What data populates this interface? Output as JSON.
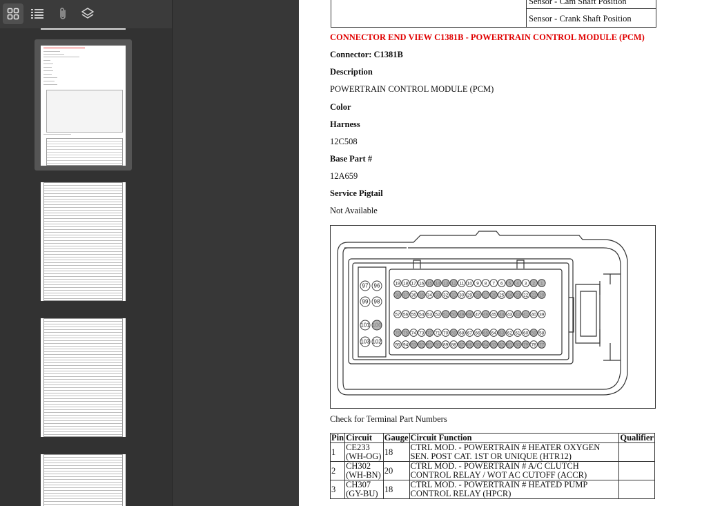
{
  "toolbar": {
    "buttons": [
      {
        "name": "thumbnails-view",
        "icon": "grid-icon"
      },
      {
        "name": "outline-view",
        "icon": "list-icon"
      },
      {
        "name": "attachments-view",
        "icon": "paperclip-icon"
      },
      {
        "name": "layers-view",
        "icon": "layers-icon"
      }
    ]
  },
  "document": {
    "top_table": {
      "row1": "Sensor - Cam Shaft Position",
      "row2": "Sensor - Crank Shaft Position"
    },
    "heading": "CONNECTOR END VIEW C1381B - POWERTRAIN CONTROL MODULE (PCM)",
    "connector": "Connector: C1381B",
    "description_label": "Description",
    "description_value": "POWERTRAIN CONTROL MODULE (PCM)",
    "color_label": "Color",
    "harness_label": "Harness",
    "harness_value": "12C508",
    "base_part_label": "Base Part #",
    "base_part_value": "12A659",
    "service_pigtail_label": "Service Pigtail",
    "service_pigtail_value": "Not Available",
    "figure": {
      "pins_row1": [
        "19",
        "18",
        "17",
        "16",
        "15",
        "14",
        "13",
        "12",
        "11",
        "10",
        "9",
        "8",
        "7",
        "6",
        "5",
        "4",
        "3",
        "2",
        "1"
      ],
      "pins_row2": [
        "38",
        "37",
        "36",
        "35",
        "34",
        "33",
        "32",
        "31",
        "30",
        "29",
        "28",
        "27",
        "26",
        "25",
        "24",
        "23",
        "22",
        "21",
        "20"
      ],
      "pins_row3": [
        "57",
        "56",
        "55",
        "54",
        "53",
        "52",
        "51",
        "50",
        "49",
        "48",
        "47",
        "46",
        "45",
        "44",
        "43",
        "42",
        "41",
        "40",
        "39"
      ],
      "pins_row4": [
        "76",
        "75",
        "74",
        "73",
        "72",
        "71",
        "70",
        "69",
        "68",
        "67",
        "66",
        "65",
        "64",
        "63",
        "62",
        "61",
        "60",
        "59",
        "58"
      ],
      "pins_row5": [
        "95",
        "94",
        "93",
        "92",
        "91",
        "90",
        "89",
        "88",
        "87",
        "86",
        "85",
        "84",
        "83",
        "82",
        "81",
        "80",
        "79",
        "78",
        "77"
      ],
      "left_pins": [
        [
          "97",
          "96"
        ],
        [
          "99",
          "98"
        ],
        [
          "101",
          "100"
        ],
        [
          "103",
          "102"
        ]
      ]
    },
    "check_terminal": "Check for Terminal Part Numbers",
    "pin_table": {
      "headers": [
        "Pin",
        "Circuit",
        "Gauge",
        "Circuit Function",
        "Qualifier"
      ],
      "rows": [
        {
          "pin": "1",
          "circuit": "CE233 (WH-OG)",
          "gauge": "18",
          "function": "CTRL MOD. - POWERTRAIN # HEATER OXYGEN SEN. POST CAT. 1ST OR UNIQUE (HTR12)",
          "qualifier": ""
        },
        {
          "pin": "2",
          "circuit": "CH302 (WH-BN)",
          "gauge": "20",
          "function": "CTRL MOD. - POWERTRAIN # A/C CLUTCH CONTROL RELAY / WOT AC CUTOFF (ACCR)",
          "qualifier": ""
        },
        {
          "pin": "3",
          "circuit": "CH307 (GY-BU)",
          "gauge": "18",
          "function": "CTRL MOD. - POWERTRAIN # HEATED PUMP CONTROL RELAY (HPCR)",
          "qualifier": ""
        }
      ]
    }
  }
}
